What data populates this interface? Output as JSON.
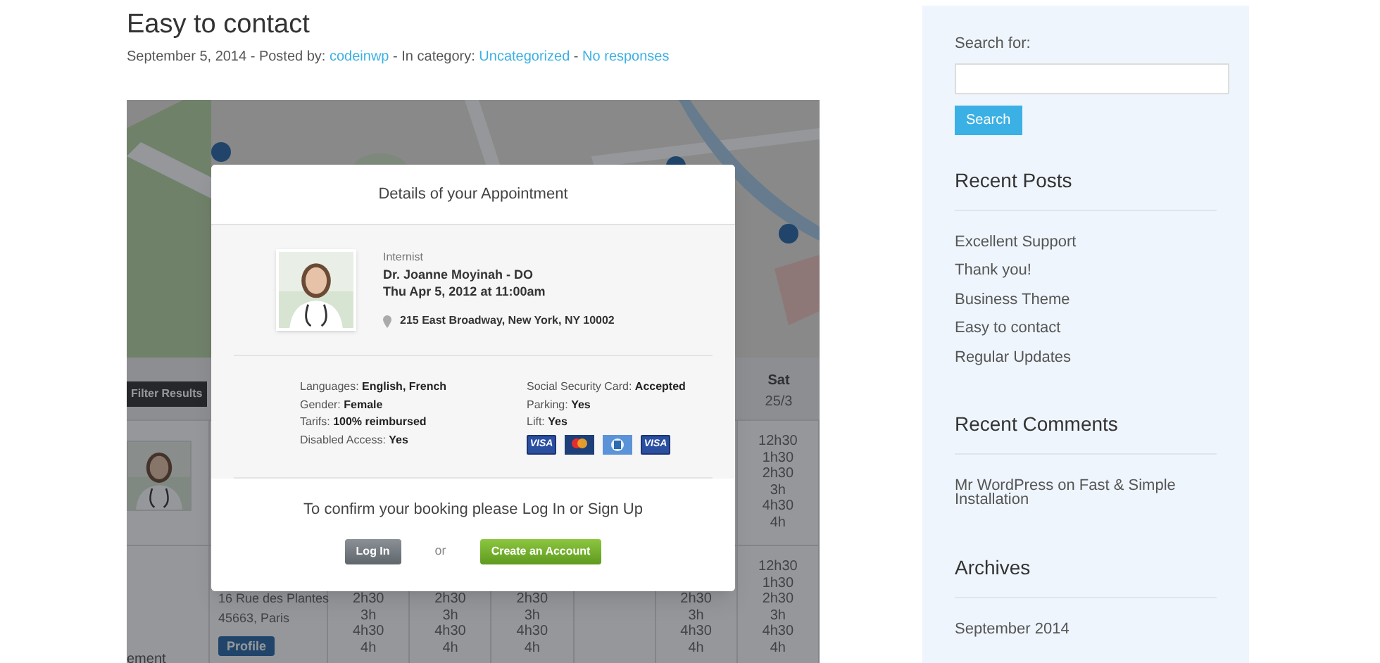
{
  "post": {
    "title": "Easy to contact",
    "meta": [
      {
        "text": "September 5, 2014 - Posted by: ",
        "link": false
      },
      {
        "text": "codeinwp",
        "link": true
      },
      {
        "text": " - In category: ",
        "link": false
      },
      {
        "text": "Uncategorized",
        "link": true
      },
      {
        "text": " - ",
        "link": false
      },
      {
        "text": "No responses",
        "link": true
      }
    ]
  },
  "screenshot": {
    "map": {
      "kind": "picture"
    },
    "header": {
      "filter_button": "Filter Results",
      "day": "Sat",
      "date": "25/3"
    },
    "rows": [
      {
        "photo": {
          "kind": "picture"
        },
        "columns": [
          [],
          [],
          [],
          [],
          [],
          [
            "12h30",
            "1h30",
            "2h30",
            "3h",
            "4h30",
            "4h"
          ]
        ]
      },
      {
        "left_text": "ement",
        "address": [
          "16 Rue des Plantes",
          "45663, Paris"
        ],
        "profile_button": "Profile",
        "columns": [
          [
            "2h30",
            "3h",
            "4h30",
            "4h"
          ],
          [
            "2h30",
            "3h",
            "4h30",
            "4h"
          ],
          [
            "2h30",
            "3h",
            "4h30",
            "4h"
          ],
          [],
          [
            "2h30",
            "3h",
            "4h30",
            "4h"
          ],
          [
            "12h30",
            "1h30",
            "2h30",
            "3h",
            "4h30",
            "4h"
          ]
        ]
      }
    ],
    "modal": {
      "title": "Details of your Appointment",
      "doctor": {
        "specialty": "Internist",
        "name": "Dr. Joanne Moyinah - DO",
        "datetime": "Thu Apr 5, 2012 at 11:00am",
        "address": "215 East Broadway, New York, NY 10002"
      },
      "details_left": [
        {
          "label": "Languages: ",
          "value": "English, French"
        },
        {
          "label": "Gender: ",
          "value": "Female"
        },
        {
          "label": "Tarifs: ",
          "value": "100% reimbursed"
        },
        {
          "label": "Disabled Access: ",
          "value": "Yes"
        }
      ],
      "details_right": [
        {
          "label": "Social Security Card: ",
          "value": "Accepted"
        },
        {
          "label": "Parking: ",
          "value": "Yes"
        },
        {
          "label": "Lift: ",
          "value": "Yes"
        }
      ],
      "cards": [
        {
          "kind": "visa",
          "label": "VISA"
        },
        {
          "kind": "mastercard"
        },
        {
          "kind": "diners"
        },
        {
          "kind": "visa",
          "label": "VISA"
        }
      ],
      "confirm": "To confirm your booking please Log In or Sign Up",
      "login_button": "Log In",
      "or": "or",
      "create_button": "Create an Account"
    }
  },
  "sidebar": {
    "search": {
      "label": "Search for:",
      "button": "Search"
    },
    "widgets": [
      {
        "title": "Recent Posts",
        "items": [
          "Excellent Support",
          "Thank you!",
          "Business Theme",
          "Easy to contact",
          "Regular Updates"
        ]
      },
      {
        "title": "Recent Comments",
        "items": [
          "Mr WordPress on Fast & Simple Installation"
        ]
      },
      {
        "title": "Archives",
        "items": [
          "September 2014"
        ]
      }
    ]
  }
}
